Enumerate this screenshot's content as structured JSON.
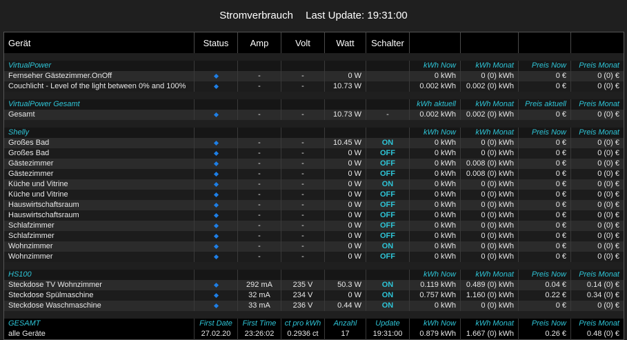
{
  "header": {
    "title": "Stromverbrauch",
    "update_label": "Last Update:",
    "update_time": "19:31:00"
  },
  "columns": [
    "Gerät",
    "Status",
    "Amp",
    "Volt",
    "Watt",
    "Schalter",
    "",
    "",
    "",
    ""
  ],
  "groups": [
    {
      "name": "VirtualPower",
      "labels": [
        "kWh Now",
        "kWh Monat",
        "Preis Now",
        "Preis Monat"
      ],
      "rows": [
        {
          "device": "Fernseher Gästezimmer.OnOff",
          "amp": "-",
          "volt": "-",
          "watt": "0 W",
          "switch": "",
          "kwh_now": "0 kWh",
          "kwh_month": "0 (0) kWh",
          "price_now": "0 €",
          "price_month": "0 (0) €"
        },
        {
          "device": "Couchlicht - Level of the light between 0% and 100%",
          "amp": "-",
          "volt": "-",
          "watt": "10.73 W",
          "switch": "",
          "kwh_now": "0.002 kWh",
          "kwh_month": "0.002 (0) kWh",
          "price_now": "0 €",
          "price_month": "0 (0) €"
        }
      ]
    },
    {
      "name": "VirtualPower Gesamt",
      "labels": [
        "kWh aktuell",
        "kWh Monat",
        "Preis aktuell",
        "Preis Monat"
      ],
      "rows": [
        {
          "device": "Gesamt",
          "amp": "-",
          "volt": "-",
          "watt": "10.73 W",
          "switch": "-",
          "kwh_now": "0.002 kWh",
          "kwh_month": "0.002 (0) kWh",
          "price_now": "0 €",
          "price_month": "0 (0) €"
        }
      ]
    },
    {
      "name": "Shelly",
      "labels": [
        "kWh Now",
        "kWh Monat",
        "Preis Now",
        "Preis Monat"
      ],
      "rows": [
        {
          "device": "Großes Bad",
          "amp": "-",
          "volt": "-",
          "watt": "10.45 W",
          "switch": "ON",
          "kwh_now": "0 kWh",
          "kwh_month": "0 (0) kWh",
          "price_now": "0 €",
          "price_month": "0 (0) €"
        },
        {
          "device": "Großes Bad",
          "amp": "-",
          "volt": "-",
          "watt": "0 W",
          "switch": "OFF",
          "kwh_now": "0 kWh",
          "kwh_month": "0 (0) kWh",
          "price_now": "0 €",
          "price_month": "0 (0) €"
        },
        {
          "device": "Gästezimmer",
          "amp": "-",
          "volt": "-",
          "watt": "0 W",
          "switch": "OFF",
          "kwh_now": "0 kWh",
          "kwh_month": "0.008 (0) kWh",
          "price_now": "0 €",
          "price_month": "0 (0) €"
        },
        {
          "device": "Gästezimmer",
          "amp": "-",
          "volt": "-",
          "watt": "0 W",
          "switch": "OFF",
          "kwh_now": "0 kWh",
          "kwh_month": "0.008 (0) kWh",
          "price_now": "0 €",
          "price_month": "0 (0) €"
        },
        {
          "device": "Küche und Vitrine",
          "amp": "-",
          "volt": "-",
          "watt": "0 W",
          "switch": "ON",
          "kwh_now": "0 kWh",
          "kwh_month": "0 (0) kWh",
          "price_now": "0 €",
          "price_month": "0 (0) €"
        },
        {
          "device": "Küche und Vitrine",
          "amp": "-",
          "volt": "-",
          "watt": "0 W",
          "switch": "OFF",
          "kwh_now": "0 kWh",
          "kwh_month": "0 (0) kWh",
          "price_now": "0 €",
          "price_month": "0 (0) €"
        },
        {
          "device": "Hauswirtschaftsraum",
          "amp": "-",
          "volt": "-",
          "watt": "0 W",
          "switch": "OFF",
          "kwh_now": "0 kWh",
          "kwh_month": "0 (0) kWh",
          "price_now": "0 €",
          "price_month": "0 (0) €"
        },
        {
          "device": "Hauswirtschaftsraum",
          "amp": "-",
          "volt": "-",
          "watt": "0 W",
          "switch": "OFF",
          "kwh_now": "0 kWh",
          "kwh_month": "0 (0) kWh",
          "price_now": "0 €",
          "price_month": "0 (0) €"
        },
        {
          "device": "Schlafzimmer",
          "amp": "-",
          "volt": "-",
          "watt": "0 W",
          "switch": "OFF",
          "kwh_now": "0 kWh",
          "kwh_month": "0 (0) kWh",
          "price_now": "0 €",
          "price_month": "0 (0) €"
        },
        {
          "device": "Schlafzimmer",
          "amp": "-",
          "volt": "-",
          "watt": "0 W",
          "switch": "OFF",
          "kwh_now": "0 kWh",
          "kwh_month": "0 (0) kWh",
          "price_now": "0 €",
          "price_month": "0 (0) €"
        },
        {
          "device": "Wohnzimmer",
          "amp": "-",
          "volt": "-",
          "watt": "0 W",
          "switch": "ON",
          "kwh_now": "0 kWh",
          "kwh_month": "0 (0) kWh",
          "price_now": "0 €",
          "price_month": "0 (0) €"
        },
        {
          "device": "Wohnzimmer",
          "amp": "-",
          "volt": "-",
          "watt": "0 W",
          "switch": "OFF",
          "kwh_now": "0 kWh",
          "kwh_month": "0 (0) kWh",
          "price_now": "0 €",
          "price_month": "0 (0) €"
        }
      ]
    },
    {
      "name": "HS100",
      "labels": [
        "kWh Now",
        "kWh Monat",
        "Preis Now",
        "Preis Monat"
      ],
      "rows": [
        {
          "device": "Steckdose TV Wohnzimmer",
          "amp": "292 mA",
          "volt": "235 V",
          "watt": "50.3 W",
          "switch": "ON",
          "kwh_now": "0.119 kWh",
          "kwh_month": "0.489 (0) kWh",
          "price_now": "0.04 €",
          "price_month": "0.14 (0) €"
        },
        {
          "device": "Steckdose Spülmaschine",
          "amp": "32 mA",
          "volt": "234 V",
          "watt": "0 W",
          "switch": "ON",
          "kwh_now": "0.757 kWh",
          "kwh_month": "1.160 (0) kWh",
          "price_now": "0.22 €",
          "price_month": "0.34 (0) €"
        },
        {
          "device": "Steckdose Waschmaschine",
          "amp": "33 mA",
          "volt": "236 V",
          "watt": "0.44 W",
          "switch": "ON",
          "kwh_now": "0 kWh",
          "kwh_month": "0 (0) kWh",
          "price_now": "0 €",
          "price_month": "0 (0) €"
        }
      ]
    }
  ],
  "footer": {
    "labels": [
      "GESAMT",
      "First Date",
      "First Time",
      "ct pro kWh",
      "Anzahl",
      "Update",
      "kWh Now",
      "kWh Monat",
      "Preis Now",
      "Preis Monat"
    ],
    "values": [
      "alle Geräte",
      "27.02.20",
      "23:26:02",
      "0.2936 ct",
      "17",
      "19:31:00",
      "0.879 kWh",
      "1.667 (0) kWh",
      "0.26 €",
      "0.48 (0) €"
    ]
  },
  "colors": {
    "accent": "#2ec4d6",
    "status_icon": "#1e7fe6",
    "background": "#1f1f1f",
    "header_bg": "#000000"
  },
  "icons": {
    "status": "diamond-status-icon"
  }
}
